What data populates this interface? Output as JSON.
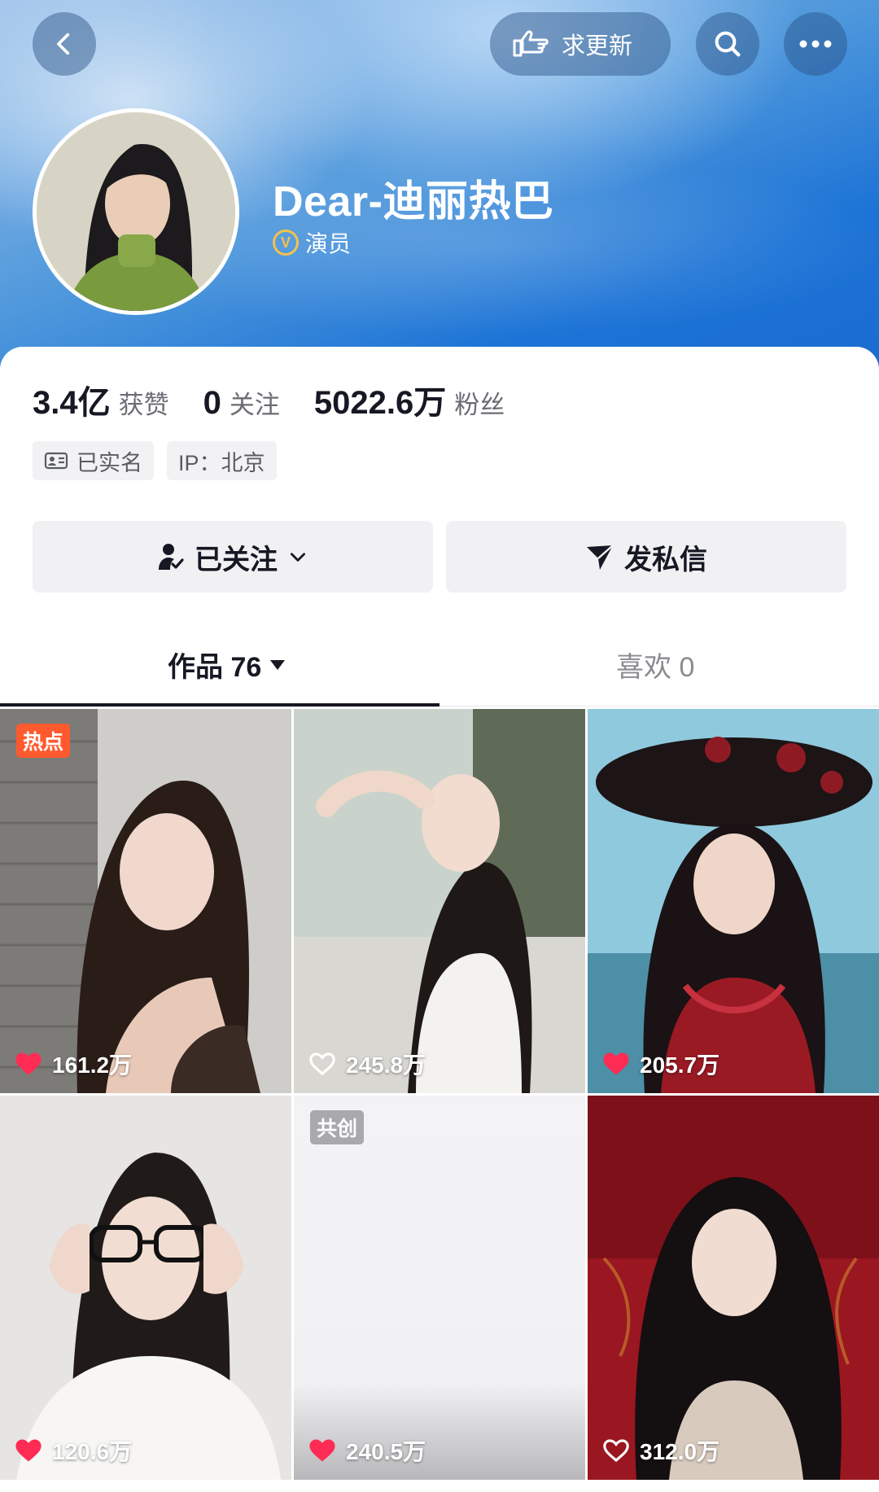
{
  "header": {
    "update_label": "求更新",
    "back_icon": "chevron-left-icon",
    "search_icon": "search-icon",
    "more_icon": "more-dots-icon"
  },
  "profile": {
    "username": "Dear-迪丽热巴",
    "verification": "演员",
    "verify_badge": "V"
  },
  "stats": [
    {
      "value": "3.4亿",
      "label": "获赞"
    },
    {
      "value": "0",
      "label": "关注"
    },
    {
      "value": "5022.6万",
      "label": "粉丝"
    }
  ],
  "tags": [
    {
      "label": "已实名",
      "icon": "id-card-icon"
    },
    {
      "label": "IP：北京",
      "icon": ""
    }
  ],
  "actions": {
    "follow_label": "已关注",
    "message_label": "发私信"
  },
  "tabs": [
    {
      "label": "作品 76",
      "active": true
    },
    {
      "label": "喜欢 0",
      "active": false
    }
  ],
  "videos": [
    {
      "badge": "热点",
      "badge_color": "#fe5a2e",
      "likes": "161.2万",
      "liked": true
    },
    {
      "badge": "",
      "badge_color": "",
      "likes": "245.8万",
      "liked": false
    },
    {
      "badge": "",
      "badge_color": "",
      "likes": "205.7万",
      "liked": true
    },
    {
      "badge": "",
      "badge_color": "",
      "likes": "120.6万",
      "liked": true
    },
    {
      "badge": "共创",
      "badge_color": "#a8a8ad",
      "likes": "240.5万",
      "liked": true
    },
    {
      "badge": "",
      "badge_color": "",
      "likes": "312.0万",
      "liked": false
    }
  ],
  "colors": {
    "like_red": "#fe2c55",
    "accent_blue": "#1d74d6"
  }
}
